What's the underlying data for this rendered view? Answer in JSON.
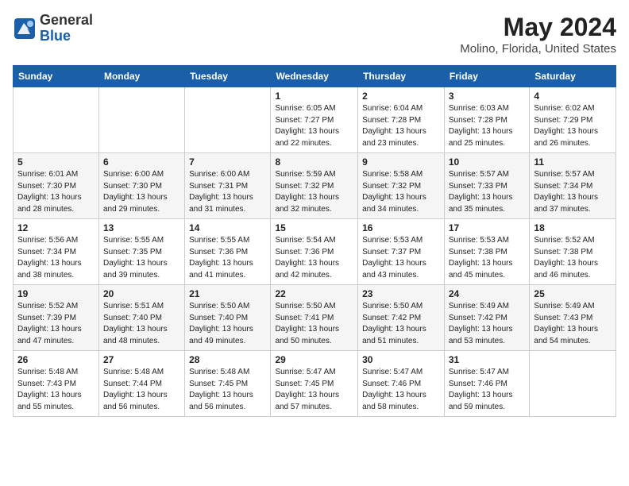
{
  "header": {
    "logo": {
      "general": "General",
      "blue": "Blue"
    },
    "title": "May 2024",
    "location": "Molino, Florida, United States"
  },
  "calendar": {
    "days_of_week": [
      "Sunday",
      "Monday",
      "Tuesday",
      "Wednesday",
      "Thursday",
      "Friday",
      "Saturday"
    ],
    "weeks": [
      [
        {
          "day": "",
          "info": ""
        },
        {
          "day": "",
          "info": ""
        },
        {
          "day": "",
          "info": ""
        },
        {
          "day": "1",
          "info": "Sunrise: 6:05 AM\nSunset: 7:27 PM\nDaylight: 13 hours\nand 22 minutes."
        },
        {
          "day": "2",
          "info": "Sunrise: 6:04 AM\nSunset: 7:28 PM\nDaylight: 13 hours\nand 23 minutes."
        },
        {
          "day": "3",
          "info": "Sunrise: 6:03 AM\nSunset: 7:28 PM\nDaylight: 13 hours\nand 25 minutes."
        },
        {
          "day": "4",
          "info": "Sunrise: 6:02 AM\nSunset: 7:29 PM\nDaylight: 13 hours\nand 26 minutes."
        }
      ],
      [
        {
          "day": "5",
          "info": "Sunrise: 6:01 AM\nSunset: 7:30 PM\nDaylight: 13 hours\nand 28 minutes."
        },
        {
          "day": "6",
          "info": "Sunrise: 6:00 AM\nSunset: 7:30 PM\nDaylight: 13 hours\nand 29 minutes."
        },
        {
          "day": "7",
          "info": "Sunrise: 6:00 AM\nSunset: 7:31 PM\nDaylight: 13 hours\nand 31 minutes."
        },
        {
          "day": "8",
          "info": "Sunrise: 5:59 AM\nSunset: 7:32 PM\nDaylight: 13 hours\nand 32 minutes."
        },
        {
          "day": "9",
          "info": "Sunrise: 5:58 AM\nSunset: 7:32 PM\nDaylight: 13 hours\nand 34 minutes."
        },
        {
          "day": "10",
          "info": "Sunrise: 5:57 AM\nSunset: 7:33 PM\nDaylight: 13 hours\nand 35 minutes."
        },
        {
          "day": "11",
          "info": "Sunrise: 5:57 AM\nSunset: 7:34 PM\nDaylight: 13 hours\nand 37 minutes."
        }
      ],
      [
        {
          "day": "12",
          "info": "Sunrise: 5:56 AM\nSunset: 7:34 PM\nDaylight: 13 hours\nand 38 minutes."
        },
        {
          "day": "13",
          "info": "Sunrise: 5:55 AM\nSunset: 7:35 PM\nDaylight: 13 hours\nand 39 minutes."
        },
        {
          "day": "14",
          "info": "Sunrise: 5:55 AM\nSunset: 7:36 PM\nDaylight: 13 hours\nand 41 minutes."
        },
        {
          "day": "15",
          "info": "Sunrise: 5:54 AM\nSunset: 7:36 PM\nDaylight: 13 hours\nand 42 minutes."
        },
        {
          "day": "16",
          "info": "Sunrise: 5:53 AM\nSunset: 7:37 PM\nDaylight: 13 hours\nand 43 minutes."
        },
        {
          "day": "17",
          "info": "Sunrise: 5:53 AM\nSunset: 7:38 PM\nDaylight: 13 hours\nand 45 minutes."
        },
        {
          "day": "18",
          "info": "Sunrise: 5:52 AM\nSunset: 7:38 PM\nDaylight: 13 hours\nand 46 minutes."
        }
      ],
      [
        {
          "day": "19",
          "info": "Sunrise: 5:52 AM\nSunset: 7:39 PM\nDaylight: 13 hours\nand 47 minutes."
        },
        {
          "day": "20",
          "info": "Sunrise: 5:51 AM\nSunset: 7:40 PM\nDaylight: 13 hours\nand 48 minutes."
        },
        {
          "day": "21",
          "info": "Sunrise: 5:50 AM\nSunset: 7:40 PM\nDaylight: 13 hours\nand 49 minutes."
        },
        {
          "day": "22",
          "info": "Sunrise: 5:50 AM\nSunset: 7:41 PM\nDaylight: 13 hours\nand 50 minutes."
        },
        {
          "day": "23",
          "info": "Sunrise: 5:50 AM\nSunset: 7:42 PM\nDaylight: 13 hours\nand 51 minutes."
        },
        {
          "day": "24",
          "info": "Sunrise: 5:49 AM\nSunset: 7:42 PM\nDaylight: 13 hours\nand 53 minutes."
        },
        {
          "day": "25",
          "info": "Sunrise: 5:49 AM\nSunset: 7:43 PM\nDaylight: 13 hours\nand 54 minutes."
        }
      ],
      [
        {
          "day": "26",
          "info": "Sunrise: 5:48 AM\nSunset: 7:43 PM\nDaylight: 13 hours\nand 55 minutes."
        },
        {
          "day": "27",
          "info": "Sunrise: 5:48 AM\nSunset: 7:44 PM\nDaylight: 13 hours\nand 56 minutes."
        },
        {
          "day": "28",
          "info": "Sunrise: 5:48 AM\nSunset: 7:45 PM\nDaylight: 13 hours\nand 56 minutes."
        },
        {
          "day": "29",
          "info": "Sunrise: 5:47 AM\nSunset: 7:45 PM\nDaylight: 13 hours\nand 57 minutes."
        },
        {
          "day": "30",
          "info": "Sunrise: 5:47 AM\nSunset: 7:46 PM\nDaylight: 13 hours\nand 58 minutes."
        },
        {
          "day": "31",
          "info": "Sunrise: 5:47 AM\nSunset: 7:46 PM\nDaylight: 13 hours\nand 59 minutes."
        },
        {
          "day": "",
          "info": ""
        }
      ]
    ]
  }
}
